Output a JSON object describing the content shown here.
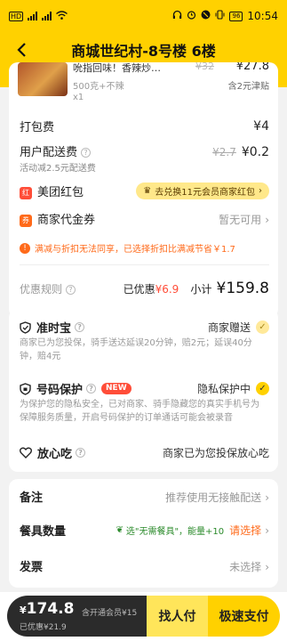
{
  "status_bar": {
    "left": "HD",
    "battery": "96",
    "time": "10:54"
  },
  "nav": {
    "title": "商城世纪村-8号楼 6楼"
  },
  "item": {
    "name": "吮指回味！香辣炒…",
    "orig_price": "¥32",
    "price": "¥27.8",
    "spec": "500克+不辣",
    "qty": "x1",
    "note": "含2元津贴"
  },
  "fees": {
    "packing_label": "打包费",
    "packing_value": "¥4",
    "delivery_label": "用户配送费",
    "delivery_orig": "¥2.7",
    "delivery_value": "¥0.2",
    "delivery_sub": "活动减2.5元配送费"
  },
  "redpacket": {
    "icon_text": "红",
    "label": "美团红包",
    "voucher_icon": "♛",
    "voucher": "去兑换11元会员商家红包"
  },
  "coupon": {
    "icon_text": "券",
    "label": "商家代金券",
    "value": "暂无可用"
  },
  "warning": {
    "text": "满减与折扣无法同享，已选择折扣比满减节省￥1.7"
  },
  "summary": {
    "rule_label": "优惠规则",
    "discount_label": "已优惠",
    "discount_value": "¥6.9",
    "subtotal_label": "小计",
    "subtotal_value": "¥159.8"
  },
  "service": {
    "ontime_title": "准时宝",
    "ontime_status": "商家赠送",
    "ontime_desc": "商家已为您投保，骑手送达延误20分钟，赔2元；延误40分钟，赔4元",
    "privacy_title": "号码保护",
    "privacy_badge": "NEW",
    "privacy_status": "隐私保护中",
    "privacy_desc": "为保护您的隐私安全，已对商家、骑手隐藏您的真实手机号为保障服务质量，开启号码保护的订单通话可能会被录音",
    "safe_title": "放心吃",
    "safe_value": "商家已为您投保放心吃"
  },
  "extras": {
    "remark_label": "备注",
    "remark_value": "推荐使用无接触配送",
    "tableware_label": "餐具数量",
    "tableware_tag": "选\"无需餐具\"，能量+10",
    "tableware_action": "请选择",
    "invoice_label": "发票",
    "invoice_value": "未选择"
  },
  "bottom": {
    "currency": "¥",
    "amount": "174.8",
    "member_note": "含开通会员¥15",
    "saved": "已优惠¥21.9",
    "friend_pay": "找人付",
    "fast_pay": "极速支付"
  }
}
